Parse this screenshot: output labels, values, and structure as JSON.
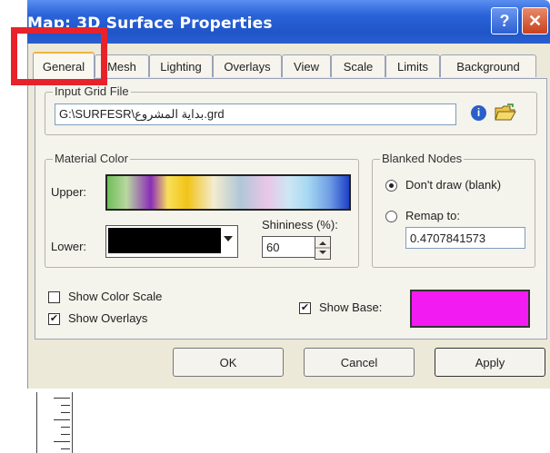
{
  "window": {
    "title": "Map: 3D Surface Properties",
    "help_glyph": "?",
    "close_glyph": "✕"
  },
  "tabs": [
    {
      "label": "General",
      "active": true
    },
    {
      "label": "Mesh"
    },
    {
      "label": "Lighting"
    },
    {
      "label": "Overlays"
    },
    {
      "label": "View"
    },
    {
      "label": "Scale"
    },
    {
      "label": "Limits"
    },
    {
      "label": "Background"
    }
  ],
  "input_grid": {
    "legend": "Input Grid File",
    "value": "G:\\SURFESR\\بداية المشروع.grd"
  },
  "material_color": {
    "legend": "Material Color",
    "upper_label": "Upper:",
    "lower_label": "Lower:",
    "shininess_label": "Shininess (%):",
    "shininess_value": "60",
    "lower_color": "#000000"
  },
  "blanked_nodes": {
    "legend": "Blanked Nodes",
    "option1": "Don't draw (blank)",
    "option2": "Remap to:",
    "remap_value": "0.4707841573"
  },
  "options": {
    "show_color_scale": "Show Color Scale",
    "show_overlays": "Show Overlays",
    "show_base": "Show Base:",
    "base_color": "#f21cf2"
  },
  "buttons": {
    "ok": "OK",
    "cancel": "Cancel",
    "apply": "Apply"
  }
}
